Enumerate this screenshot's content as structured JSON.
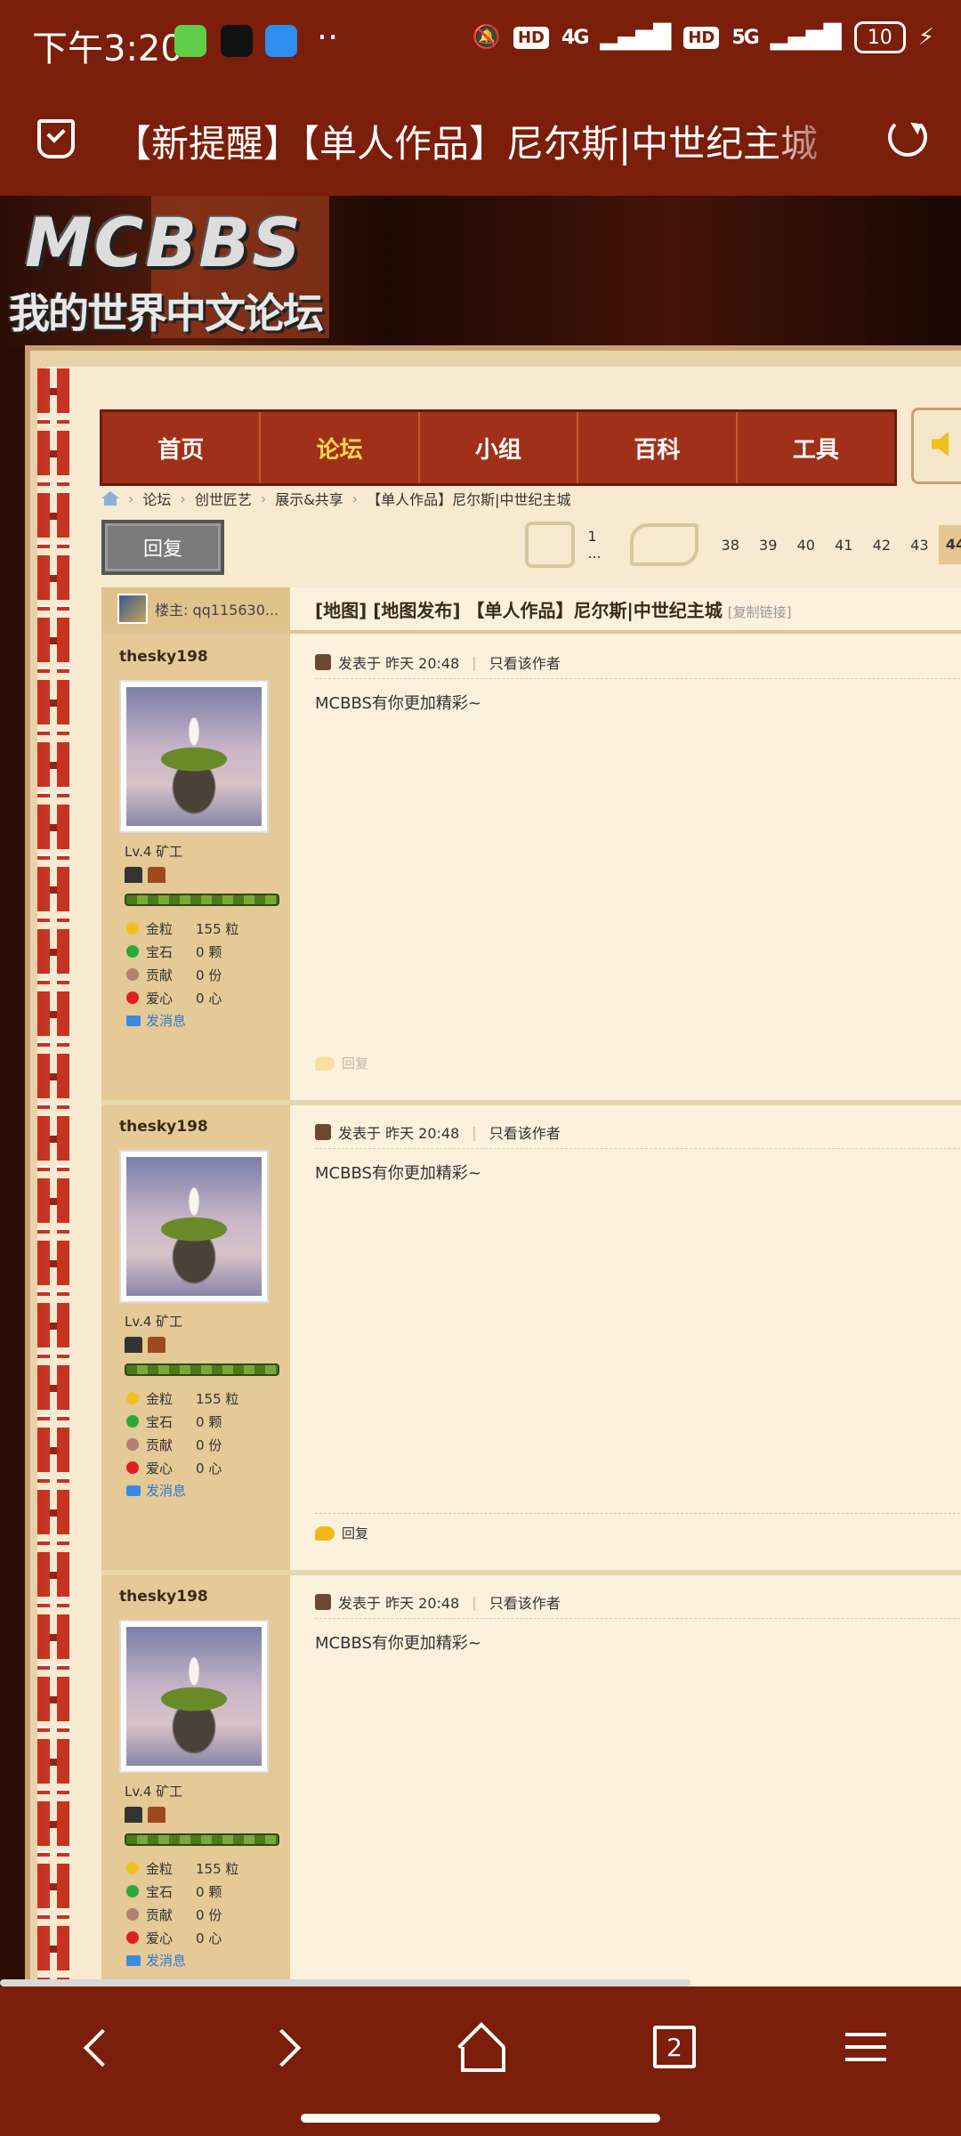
{
  "status_bar": {
    "time": "下午3:20",
    "dots": "··",
    "hd": "HD",
    "net1": "4G",
    "net2": "5G",
    "battery": "10"
  },
  "toolbar": {
    "title": "【新提醒】【单人作品】尼尔斯|中世纪主城"
  },
  "banner": {
    "logo_main": "MCBBS",
    "logo_sub": "我的世界中文论坛"
  },
  "nav": {
    "items": [
      "首页",
      "论坛",
      "小组",
      "百科",
      "工具"
    ],
    "active": "论坛"
  },
  "breadcrumb": [
    "论坛",
    "创世匠艺",
    "展示&共享",
    "【单人作品】尼尔斯|中世纪主城"
  ],
  "reply_button": "回复",
  "pager": {
    "first": "1 ...",
    "pages": [
      "38",
      "39",
      "40",
      "41",
      "42",
      "43",
      "44"
    ],
    "current": "44"
  },
  "thread": {
    "op_label": "楼主: qq115630...",
    "title": "[地图] [地图发布] 【单人作品】尼尔斯|中世纪主城",
    "copy_link": "[复制链接]"
  },
  "posts": [
    {
      "author": "thesky198",
      "level": "Lv.4 矿工",
      "stats": [
        {
          "label": "金粒",
          "value": "155 粒",
          "color": "#f0c020"
        },
        {
          "label": "宝石",
          "value": "0 颗",
          "color": "#2aa83a"
        },
        {
          "label": "贡献",
          "value": "0 份",
          "color": "#b08070"
        },
        {
          "label": "爱心",
          "value": "0 心",
          "color": "#e02020"
        }
      ],
      "send_msg": "发消息",
      "posted": "发表于 昨天 20:48",
      "only_author": "只看该作者",
      "content": "MCBBS有你更加精彩~",
      "reply": "回复"
    },
    {
      "author": "thesky198",
      "level": "Lv.4 矿工",
      "stats": [
        {
          "label": "金粒",
          "value": "155 粒",
          "color": "#f0c020"
        },
        {
          "label": "宝石",
          "value": "0 颗",
          "color": "#2aa83a"
        },
        {
          "label": "贡献",
          "value": "0 份",
          "color": "#b08070"
        },
        {
          "label": "爱心",
          "value": "0 心",
          "color": "#e02020"
        }
      ],
      "send_msg": "发消息",
      "posted": "发表于 昨天 20:48",
      "only_author": "只看该作者",
      "content": "MCBBS有你更加精彩~",
      "reply": "回复"
    },
    {
      "author": "thesky198",
      "level": "Lv.4 矿工",
      "stats": [
        {
          "label": "金粒",
          "value": "155 粒",
          "color": "#f0c020"
        },
        {
          "label": "宝石",
          "value": "0 颗",
          "color": "#2aa83a"
        },
        {
          "label": "贡献",
          "value": "0 份",
          "color": "#b08070"
        },
        {
          "label": "爱心",
          "value": "0 心",
          "color": "#e02020"
        }
      ],
      "send_msg": "发消息",
      "posted": "发表于 昨天 20:48",
      "only_author": "只看该作者",
      "content": "MCBBS有你更加精彩~",
      "reply": "回复"
    }
  ],
  "bottom_bar": {
    "tab_count": "2"
  },
  "colors": {
    "theme": "#7b1e0a",
    "nav_bg": "#a0301a",
    "nav_active": "#ffd84a",
    "sidebar": "#e5c997"
  }
}
